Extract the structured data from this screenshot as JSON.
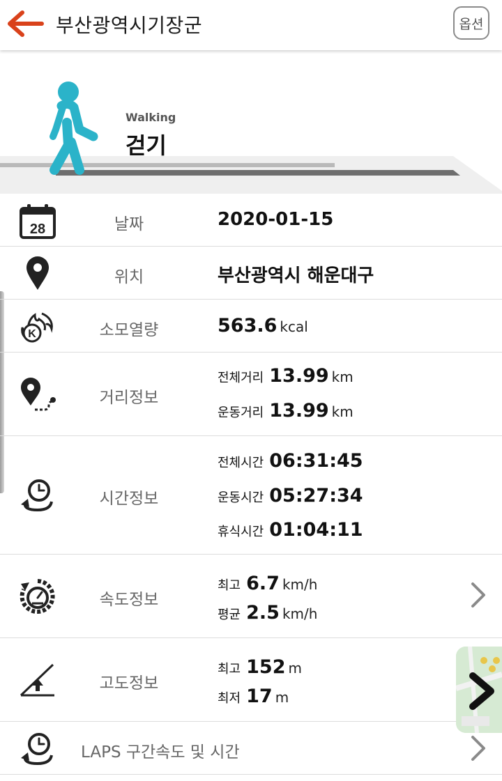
{
  "header": {
    "title": "부산광역시기장군",
    "option_label": "옵션"
  },
  "activity": {
    "name_en": "Walking",
    "name_ko": "걷기"
  },
  "rows": {
    "date": {
      "label": "날짜",
      "value": "2020-01-15",
      "icon_text": "28"
    },
    "location": {
      "label": "위치",
      "value": "부산광역시 해운대구"
    },
    "calories": {
      "label": "소모열량",
      "value": "563.6",
      "unit": "kcal",
      "icon_text": "K"
    },
    "distance": {
      "label": "거리정보",
      "total_label": "전체거리",
      "total_value": "13.99",
      "total_unit": "km",
      "exercise_label": "운동거리",
      "exercise_value": "13.99",
      "exercise_unit": "km"
    },
    "time": {
      "label": "시간정보",
      "total_label": "전체시간",
      "total_value": "06:31:45",
      "exercise_label": "운동시간",
      "exercise_value": "05:27:34",
      "rest_label": "휴식시간",
      "rest_value": "01:04:11"
    },
    "speed": {
      "label": "속도정보",
      "max_label": "최고",
      "max_value": "6.7",
      "max_unit": "km/h",
      "avg_label": "평균",
      "avg_value": "2.5",
      "avg_unit": "km/h"
    },
    "altitude": {
      "label": "고도정보",
      "max_label": "최고",
      "max_value": "152",
      "max_unit": "m",
      "min_label": "최저",
      "min_value": "17",
      "min_unit": "m"
    },
    "laps": {
      "label": "LAPS 구간속도 및 시간"
    }
  },
  "colors": {
    "accent": "#d9421b",
    "walker": "#2bb3c9",
    "label": "#666666",
    "divider": "#dcdcdc"
  },
  "icons": [
    "back-arrow-icon",
    "calendar-icon",
    "location-pin-icon",
    "calorie-fire-icon",
    "distance-route-icon",
    "time-clock-icon",
    "speedometer-icon",
    "altitude-icon",
    "laps-clock-icon",
    "chevron-right-icon"
  ]
}
